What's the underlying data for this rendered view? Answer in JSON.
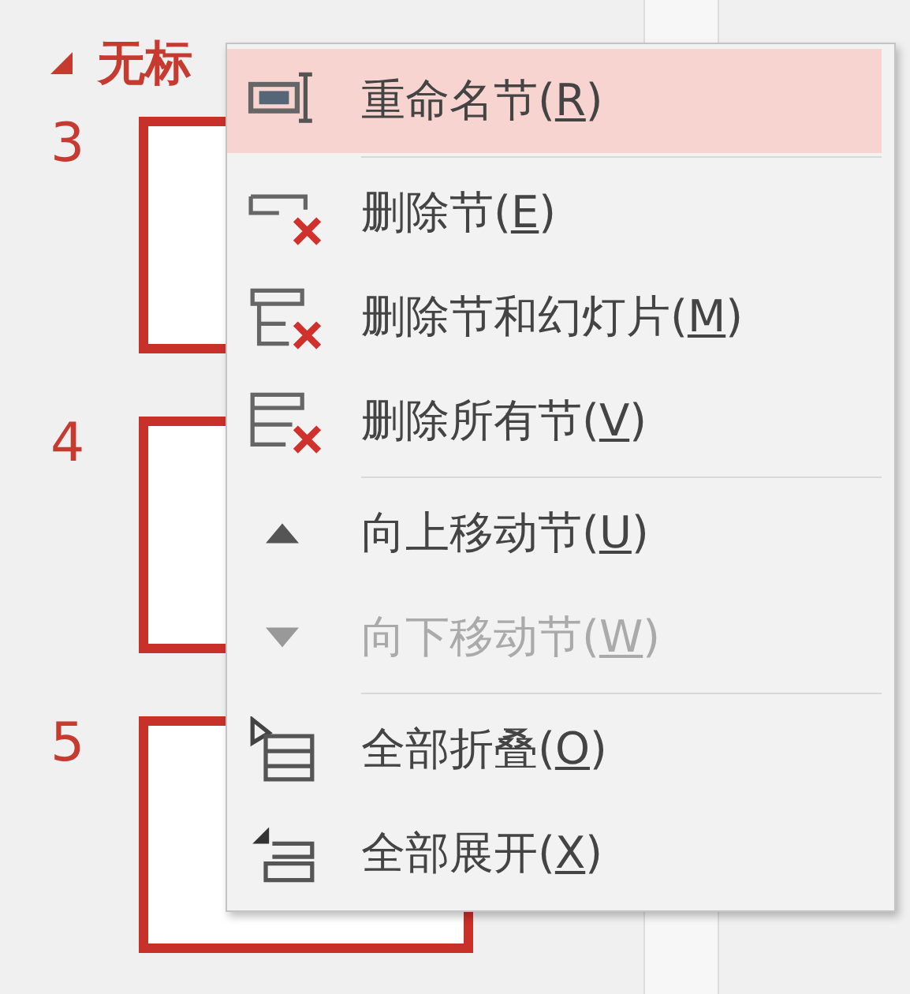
{
  "section": {
    "title": "无标",
    "expanded": true
  },
  "slides": [
    {
      "number": "3"
    },
    {
      "number": "4"
    },
    {
      "number": "5"
    }
  ],
  "context_menu": {
    "items": [
      {
        "kind": "item",
        "text": "重命名节(",
        "access_key": "R",
        "text_after": ")",
        "selected": true,
        "disabled": false
      },
      {
        "kind": "separator"
      },
      {
        "kind": "item",
        "text": "删除节(",
        "access_key": "E",
        "text_after": ")",
        "selected": false,
        "disabled": false
      },
      {
        "kind": "item",
        "text": "删除节和幻灯片(",
        "access_key": "M",
        "text_after": ")",
        "selected": false,
        "disabled": false
      },
      {
        "kind": "item",
        "text": "删除所有节(",
        "access_key": "V",
        "text_after": ")",
        "selected": false,
        "disabled": false
      },
      {
        "kind": "separator"
      },
      {
        "kind": "item",
        "text": "向上移动节(",
        "access_key": "U",
        "text_after": ")",
        "selected": false,
        "disabled": false
      },
      {
        "kind": "item",
        "text": "向下移动节(",
        "access_key": "W",
        "text_after": ")",
        "selected": false,
        "disabled": true
      },
      {
        "kind": "separator"
      },
      {
        "kind": "item",
        "text": "全部折叠(",
        "access_key": "O",
        "text_after": ")",
        "selected": false,
        "disabled": false
      },
      {
        "kind": "item",
        "text": "全部展开(",
        "access_key": "X",
        "text_after": ")",
        "selected": false,
        "disabled": false
      }
    ]
  }
}
